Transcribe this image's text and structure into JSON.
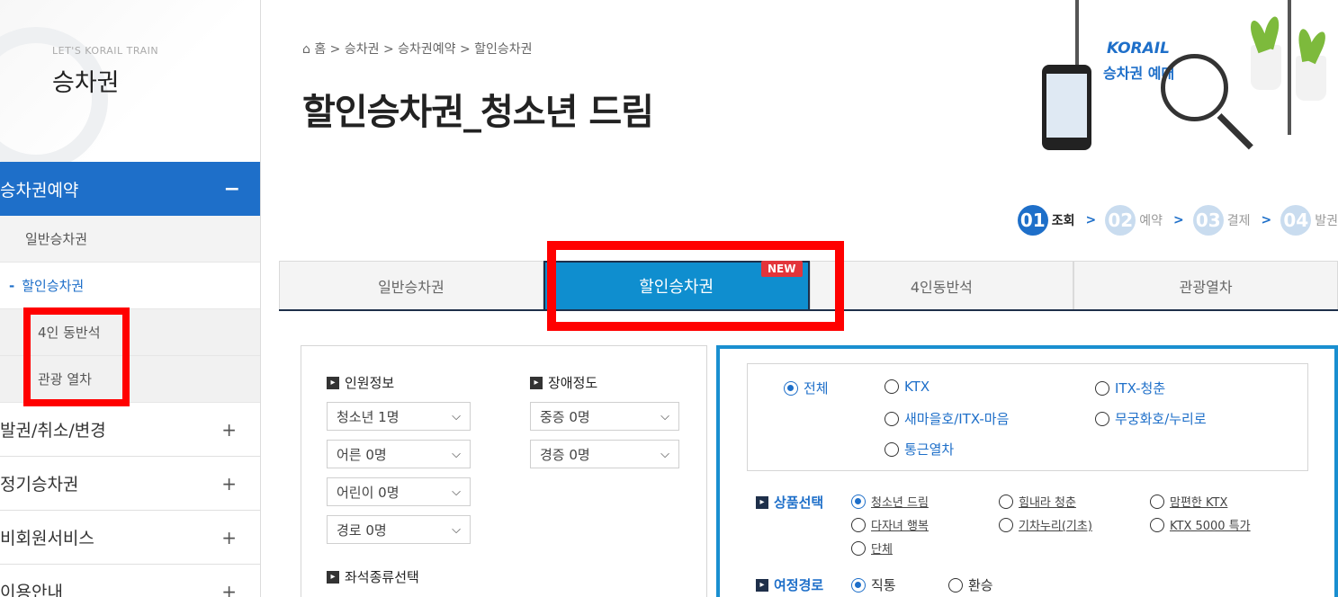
{
  "sidebar": {
    "eyebrow": "LET'S KORAIL TRAIN",
    "title": "승차권",
    "active_menu": {
      "label": "승차권예약",
      "toggle": "−"
    },
    "sub_items": [
      "일반승차권",
      "할인승차권",
      "4인 동반석",
      "관광 열차"
    ],
    "current_dash": "-",
    "menus": [
      {
        "label": "발권/취소/변경",
        "toggle": "+"
      },
      {
        "label": "정기승차권",
        "toggle": "+"
      },
      {
        "label": "비회원서비스",
        "toggle": "+"
      },
      {
        "label": "이용안내",
        "toggle": "+"
      }
    ]
  },
  "breadcrumb": "⌂ 홈 > 승차권 > 승차권예약 > 할인승차권",
  "page_title": "할인승차권_청소년 드림",
  "hero": {
    "brand": "KORAIL",
    "subtitle": "승차권 예매"
  },
  "steps": [
    {
      "num": "01",
      "label": "조회"
    },
    {
      "num": "02",
      "label": "예약"
    },
    {
      "num": "03",
      "label": "결제"
    },
    {
      "num": "04",
      "label": "발권"
    }
  ],
  "step_arrow": ">",
  "tabs": [
    "일반승차권",
    "할인승차권",
    "4인동반석",
    "관광열차"
  ],
  "new_badge": "NEW",
  "passenger": {
    "label": "인원정보",
    "selects": [
      "청소년 1명",
      "어른 0명",
      "어린이 0명",
      "경로 0명"
    ]
  },
  "disability": {
    "label": "장애정도",
    "selects": [
      "중증 0명",
      "경증 0명"
    ]
  },
  "seat": {
    "label": "좌석종류선택"
  },
  "chevron": "⌵",
  "train_types": [
    "전체",
    "KTX",
    "ITX-청춘",
    "새마을호/ITX-마음",
    "무궁화호/누리로",
    "통근열차"
  ],
  "product": {
    "label": "상품선택",
    "options": [
      "청소년 드림",
      "힘내라 청춘",
      "맘편한 KTX",
      "다자녀 행복",
      "기차누리(기초)",
      "KTX 5000 특가",
      "단체"
    ]
  },
  "route": {
    "label": "여정경로",
    "options": [
      "직통",
      "환승"
    ]
  },
  "colors": {
    "primary": "#1e6fc9",
    "tab_active": "#0f8ecf",
    "highlight": "#ff0000"
  }
}
